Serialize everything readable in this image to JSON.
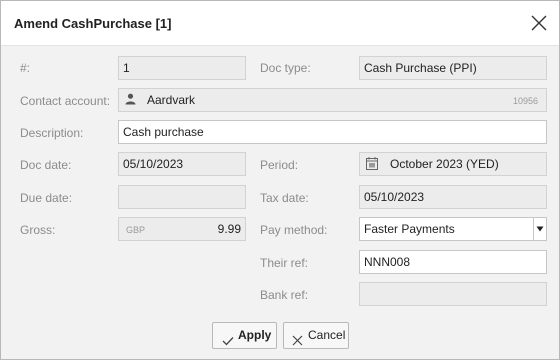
{
  "dialog": {
    "title": "Amend CashPurchase [1]"
  },
  "fields": {
    "number": {
      "label": "#:",
      "value": "1"
    },
    "doc_type": {
      "label": "Doc type:",
      "value": "Cash Purchase (PPI)"
    },
    "contact_account": {
      "label": "Contact account:",
      "value": "Aardvark",
      "code": "10956"
    },
    "description": {
      "label": "Description:",
      "value": "Cash purchase"
    },
    "doc_date": {
      "label": "Doc date:",
      "value": "05/10/2023"
    },
    "period": {
      "label": "Period:",
      "value": "October 2023 (YED)"
    },
    "due_date": {
      "label": "Due date:",
      "value": ""
    },
    "tax_date": {
      "label": "Tax date:",
      "value": "05/10/2023"
    },
    "gross": {
      "label": "Gross:",
      "currency": "GBP",
      "value": "9.99"
    },
    "pay_method": {
      "label": "Pay method:",
      "value": "Faster Payments"
    },
    "their_ref": {
      "label": "Their ref:",
      "value": "NNN008"
    },
    "bank_ref": {
      "label": "Bank ref:",
      "value": ""
    }
  },
  "buttons": {
    "apply": "Apply",
    "cancel": "Cancel"
  },
  "icons": {
    "close": "close-icon",
    "contact": "person-icon",
    "period": "calendar-icon",
    "dropdown": "dropdown-arrow-icon",
    "apply": "check-icon",
    "cancel": "x-icon"
  }
}
